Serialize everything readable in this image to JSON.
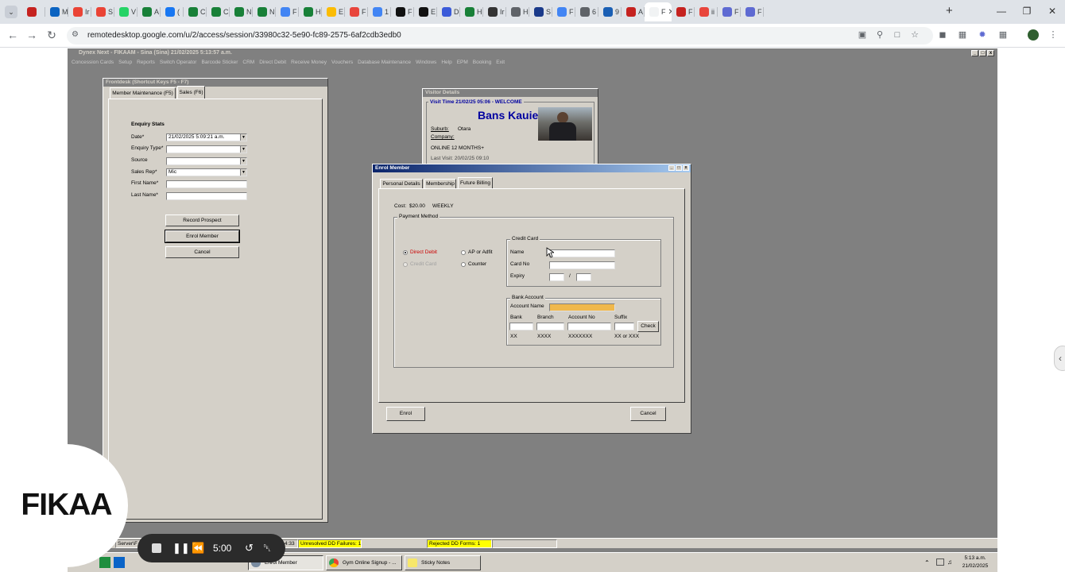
{
  "browser": {
    "tabs": [
      {
        "label": "",
        "color": "#c5221f"
      },
      {
        "label": "M",
        "color": "#0b63c1"
      },
      {
        "label": "Ir",
        "color": "#ea4335"
      },
      {
        "label": "S",
        "color": "#ea4335"
      },
      {
        "label": "V",
        "color": "#25d366"
      },
      {
        "label": "A",
        "color": "#188038"
      },
      {
        "label": "(",
        "color": "#1877f2"
      },
      {
        "label": "C",
        "color": "#188038"
      },
      {
        "label": "C",
        "color": "#188038"
      },
      {
        "label": "N",
        "color": "#188038"
      },
      {
        "label": "N",
        "color": "#188038"
      },
      {
        "label": "F",
        "color": "#4285f4"
      },
      {
        "label": "H",
        "color": "#188038"
      },
      {
        "label": "E",
        "color": "#fbbc04"
      },
      {
        "label": "F",
        "color": "#e8453c"
      },
      {
        "label": "1",
        "color": "#4285f4"
      },
      {
        "label": "F",
        "color": "#111111"
      },
      {
        "label": "E",
        "color": "#111111"
      },
      {
        "label": "D",
        "color": "#3b5bd9"
      },
      {
        "label": "H",
        "color": "#188038"
      },
      {
        "label": "Ir",
        "color": "#333333"
      },
      {
        "label": "H",
        "color": "#5f6368"
      },
      {
        "label": "S",
        "color": "#1a3a8a"
      },
      {
        "label": "F",
        "color": "#4285f4"
      },
      {
        "label": "6",
        "color": "#5f6368"
      },
      {
        "label": "9",
        "color": "#1a5fb4"
      },
      {
        "label": "A",
        "color": "#c5221f"
      },
      {
        "label": "F",
        "color": "#ffffff",
        "active": true
      },
      {
        "label": "F",
        "color": "#c5221f"
      },
      {
        "label": "ii",
        "color": "#e8453c"
      },
      {
        "label": "F",
        "color": "#5e6ad2"
      },
      {
        "label": "F",
        "color": "#5e6ad2"
      }
    ],
    "url": "remotedesktop.google.com/u/2/access/session/33980c32-5e90-fc89-2575-6af2cdb3edb0"
  },
  "app": {
    "title": "Dynex Next - FIKAAM - Sina (Sina)      21/02/2025 5:13:57 a.m.",
    "menu": [
      "Concession Cards",
      "Setup",
      "Reports",
      "Switch Operator",
      "Barcode Sticker",
      "CRM",
      "Direct Debit",
      "Receive Money",
      "Vouchers",
      "Database Maintenance",
      "Windows",
      "Help",
      "EPM",
      "Booking",
      "Exit"
    ]
  },
  "frontdesk": {
    "title": "Frontdesk (Shortcut Keys F5 - F7)",
    "tabs": [
      "Member Maintenance (F5)",
      "Sales (F6)"
    ],
    "heading": "Enquiry Stats",
    "labels": {
      "date": "Date*",
      "enquiry_type": "Enquiry Type*",
      "source": "Source",
      "sales_rep": "Sales Rep*",
      "first_name": "First Name*",
      "last_name": "Last Name*"
    },
    "values": {
      "date": "21/02/2025 5:09:21 a.m.",
      "enquiry_type": "",
      "source": "",
      "sales_rep": "Mic",
      "first_name": "",
      "last_name": ""
    },
    "buttons": {
      "record_prospect": "Record Prospect",
      "enrol_member": "Enrol Member",
      "cancel": "Cancel"
    }
  },
  "visitor": {
    "title": "Visitor Details",
    "visit_line": "Visit Time 21/02/25 05:06 - WELCOME",
    "name": "Bans Kauie",
    "suburb_label": "Suburb:",
    "suburb": "Otara",
    "company_label": "Company:",
    "membership": "ONLINE 12 MONTHS+",
    "cut_line": "Last Visit: 20/02/25 09:10"
  },
  "enrol": {
    "title": "Enrol Member",
    "tabs": [
      "Personal Details",
      "Membership",
      "Future Billing"
    ],
    "cost_label": "Cost:",
    "cost_value": "$20.00",
    "cost_period": "WEEKLY",
    "payment_method": "Payment Method",
    "options": {
      "direct_debit": "Direct Debit",
      "ap_or_adfit": "AP or Adfit",
      "credit_card": "Credit Card",
      "counter": "Counter"
    },
    "credit_card_group": "Credit Card",
    "cc_labels": {
      "name": "Name",
      "card_no": "Card No",
      "expiry": "Expiry"
    },
    "cc_values": {
      "name": "",
      "card_no": "",
      "expiry_month": "",
      "expiry_year": ""
    },
    "expiry_separator": "/",
    "bank_group": "Bank Account",
    "account_name_label": "Account Name",
    "account_name": "",
    "bank_cols": [
      "Bank",
      "Branch",
      "Account No",
      "Suffix"
    ],
    "bank_hints": [
      "XX",
      "XXXX",
      "XXXXXXX",
      "XX or XXX"
    ],
    "check": "Check",
    "enrol_btn": "Enrol",
    "cancel_btn": "Cancel",
    "colors": {
      "direct_debit": "#cc0000",
      "account_name_bg": "#f0b84c"
    }
  },
  "statusbar": {
    "server": "Server\\F",
    "time_fragment": "4:33",
    "unresolved": "Unresolved DD Failures: 1",
    "rejected": "Rejected DD Forms: 1",
    "highlight": "#ffff00"
  },
  "taskbar": {
    "items": [
      "Enrol Member",
      "Gym Online Signup - ...",
      "Sticky Notes"
    ],
    "clock_time": "5:13 a.m.",
    "clock_date": "21/02/2025"
  },
  "overlay": {
    "logo": "FIKAA",
    "recorder_time": "5:00"
  }
}
